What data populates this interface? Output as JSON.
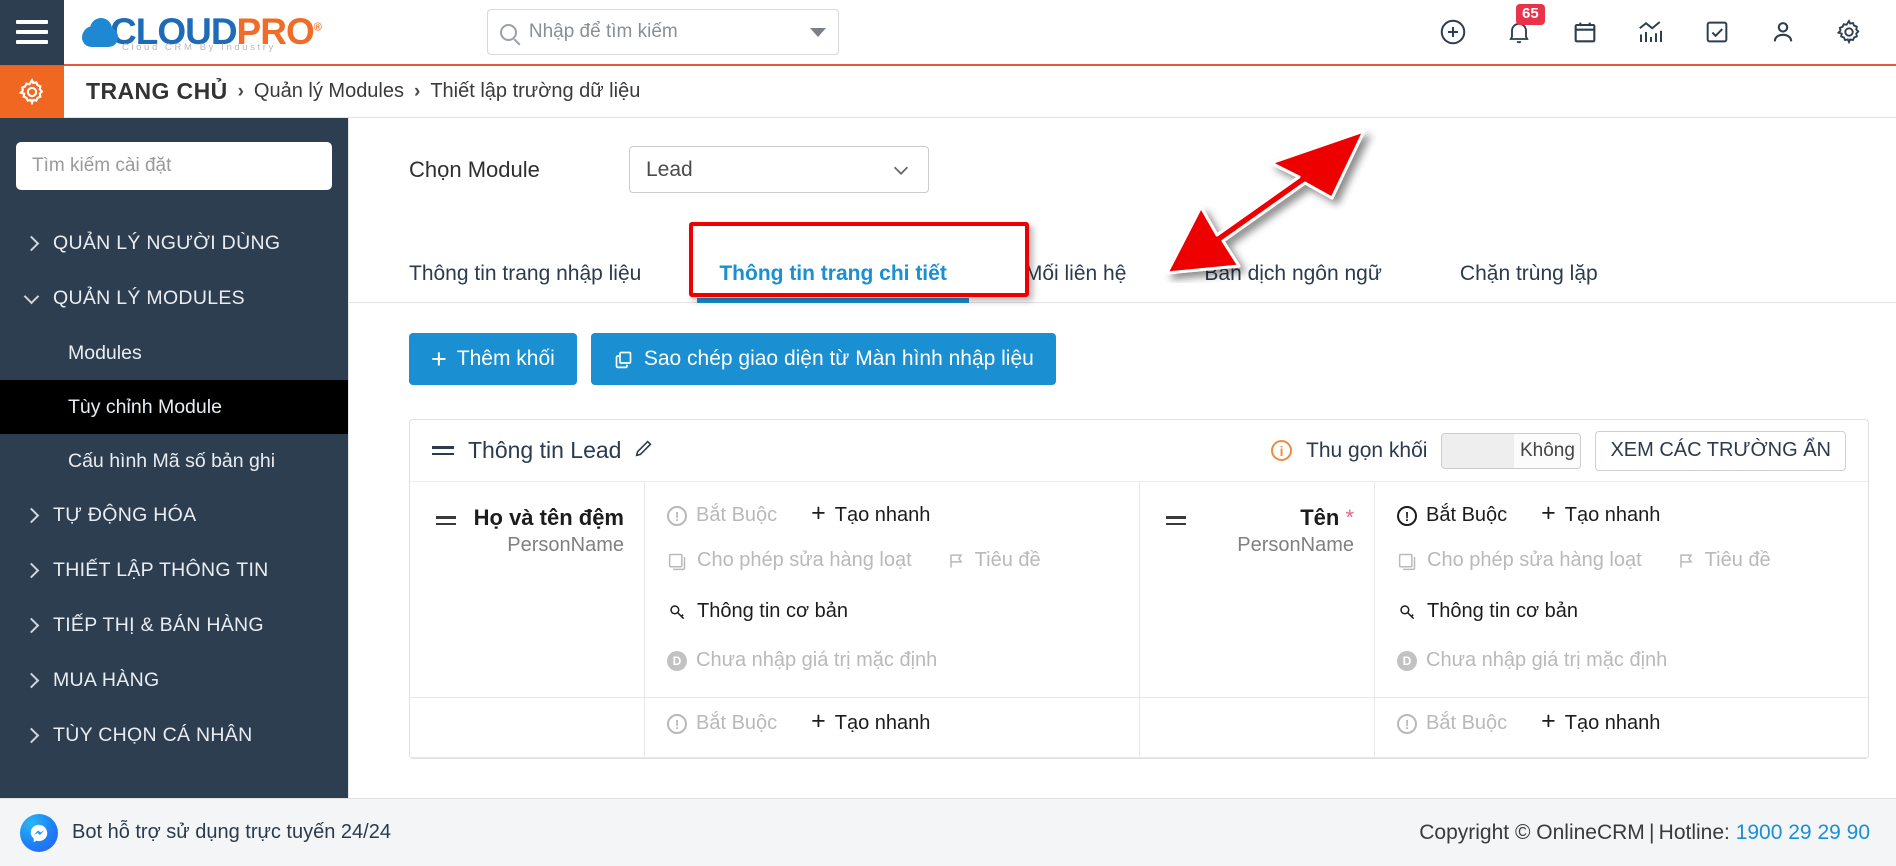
{
  "topbar": {
    "menu_icon": "hamburger-icon",
    "brand": {
      "part1": "CLOUD",
      "part2": "PRO",
      "reg": "®",
      "tagline": "Cloud CRM By Industry"
    },
    "search": {
      "placeholder": "Nhập để tìm kiếm",
      "value": ""
    },
    "icons": [
      {
        "name": "add-circle-icon",
        "badge": ""
      },
      {
        "name": "bell-icon",
        "badge": "65"
      },
      {
        "name": "calendar-icon",
        "badge": ""
      },
      {
        "name": "analytics-icon",
        "badge": ""
      },
      {
        "name": "task-check-icon",
        "badge": ""
      },
      {
        "name": "user-icon",
        "badge": ""
      },
      {
        "name": "gear-icon",
        "badge": ""
      }
    ],
    "notification_count": "65"
  },
  "breadcrumb": {
    "home": "TRANG CHỦ",
    "sep": "›",
    "item2": "Quản lý Modules",
    "item3": "Thiết lập trường dữ liệu"
  },
  "sidebar": {
    "search_placeholder": "Tìm kiếm cài đặt",
    "search_value": "",
    "groups": [
      {
        "label": "QUẢN LÝ NGƯỜI DÙNG",
        "expanded": false
      },
      {
        "label": "QUẢN LÝ MODULES",
        "expanded": true
      },
      {
        "label": "TỰ ĐỘNG HÓA",
        "expanded": false
      },
      {
        "label": "THIẾT LẬP THÔNG TIN",
        "expanded": false
      },
      {
        "label": "TIẾP THỊ & BÁN HÀNG",
        "expanded": false
      },
      {
        "label": "MUA HÀNG",
        "expanded": false
      },
      {
        "label": "TÙY CHỌN CÁ NHÂN",
        "expanded": false
      }
    ],
    "modules_children": [
      {
        "label": "Modules",
        "active": false
      },
      {
        "label": "Tùy chỉnh Module",
        "active": true
      },
      {
        "label": "Cấu hình Mã số bản ghi",
        "active": false
      }
    ]
  },
  "main": {
    "module_picker": {
      "label": "Chọn Module",
      "value": "Lead"
    },
    "tabs": [
      {
        "label": "Thông tin trang nhập liệu",
        "active": false
      },
      {
        "label": "Thông tin trang chi tiết",
        "active": true
      },
      {
        "label": "Mối liên hệ",
        "active": false
      },
      {
        "label": "Bản dịch ngôn ngữ",
        "active": false
      },
      {
        "label": "Chặn trùng lặp",
        "active": false
      }
    ],
    "buttons": [
      {
        "name": "add-block-button",
        "icon": "plus-icon",
        "label": "Thêm khối"
      },
      {
        "name": "copy-layout-button",
        "icon": "copy-icon",
        "label": "Sao chép giao diện từ Màn hình nhập liệu"
      }
    ],
    "block": {
      "title": "Thông tin Lead",
      "collapse_label": "Thu gọn khối",
      "toggle_value": "Không",
      "hidden_fields_button": "XEM CÁC TRƯỜNG ẨN"
    },
    "fields": [
      {
        "name": "Họ và tên đệm",
        "required_mark": "",
        "type": "PersonName",
        "required_label": "Bắt Buộc",
        "required_on": false,
        "quick_create_label": "Tạo nhanh",
        "quick_create_on": true,
        "mass_edit_label": "Cho phép sửa hàng loạt",
        "mass_edit_on": false,
        "header_label": "Tiêu đề",
        "header_on": false,
        "key_label": "Thông tin cơ bản",
        "key_on": true,
        "default_label": "Chưa nhập giá trị mặc định",
        "default_on": false
      },
      {
        "name": "Tên",
        "required_mark": "*",
        "type": "PersonName",
        "required_label": "Bắt Buộc",
        "required_on": true,
        "quick_create_label": "Tạo nhanh",
        "quick_create_on": true,
        "mass_edit_label": "Cho phép sửa hàng loạt",
        "mass_edit_on": false,
        "header_label": "Tiêu đề",
        "header_on": false,
        "key_label": "Thông tin cơ bản",
        "key_on": true,
        "default_label": "Chưa nhập giá trị mặc định",
        "default_on": false
      }
    ],
    "partial_row": {
      "required_label": "Bắt Buộc",
      "quick_create_label": "Tạo nhanh"
    }
  },
  "footer": {
    "bot_label": "Bot hỗ trợ sử dụng trực tuyến 24/24",
    "copyright": "Copyright © OnlineCRM | Hotline: ",
    "hotline": "1900 29 29 90"
  },
  "annotation": {
    "arrow_color": "#ee0000",
    "highlight_color": "#ef0000"
  }
}
